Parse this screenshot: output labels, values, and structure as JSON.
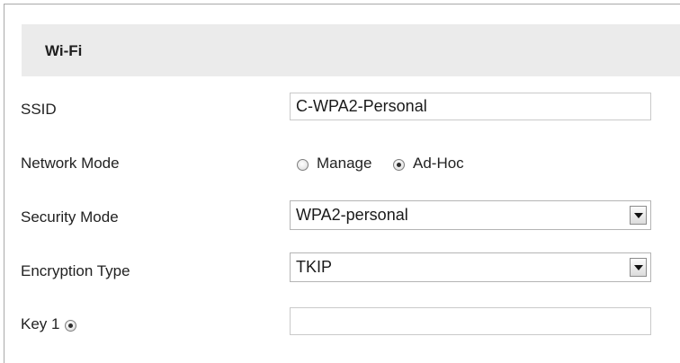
{
  "section": {
    "title": "Wi-Fi"
  },
  "ssid": {
    "label": "SSID",
    "value": "C-WPA2-Personal"
  },
  "network_mode": {
    "label": "Network Mode",
    "options": [
      {
        "label": "Manage",
        "selected": false
      },
      {
        "label": "Ad-Hoc",
        "selected": true
      }
    ]
  },
  "security_mode": {
    "label": "Security Mode",
    "selected": "WPA2-personal"
  },
  "encryption_type": {
    "label": "Encryption Type",
    "selected": "TKIP"
  },
  "key1": {
    "label": "Key 1",
    "selected": true,
    "value": ""
  },
  "icons": {
    "dropdown": "chevron-down-icon",
    "radio": "radio-button-icon"
  },
  "colors": {
    "header_background": "#ebebeb",
    "frame_border": "#a9a9a9",
    "text": "#222222"
  }
}
